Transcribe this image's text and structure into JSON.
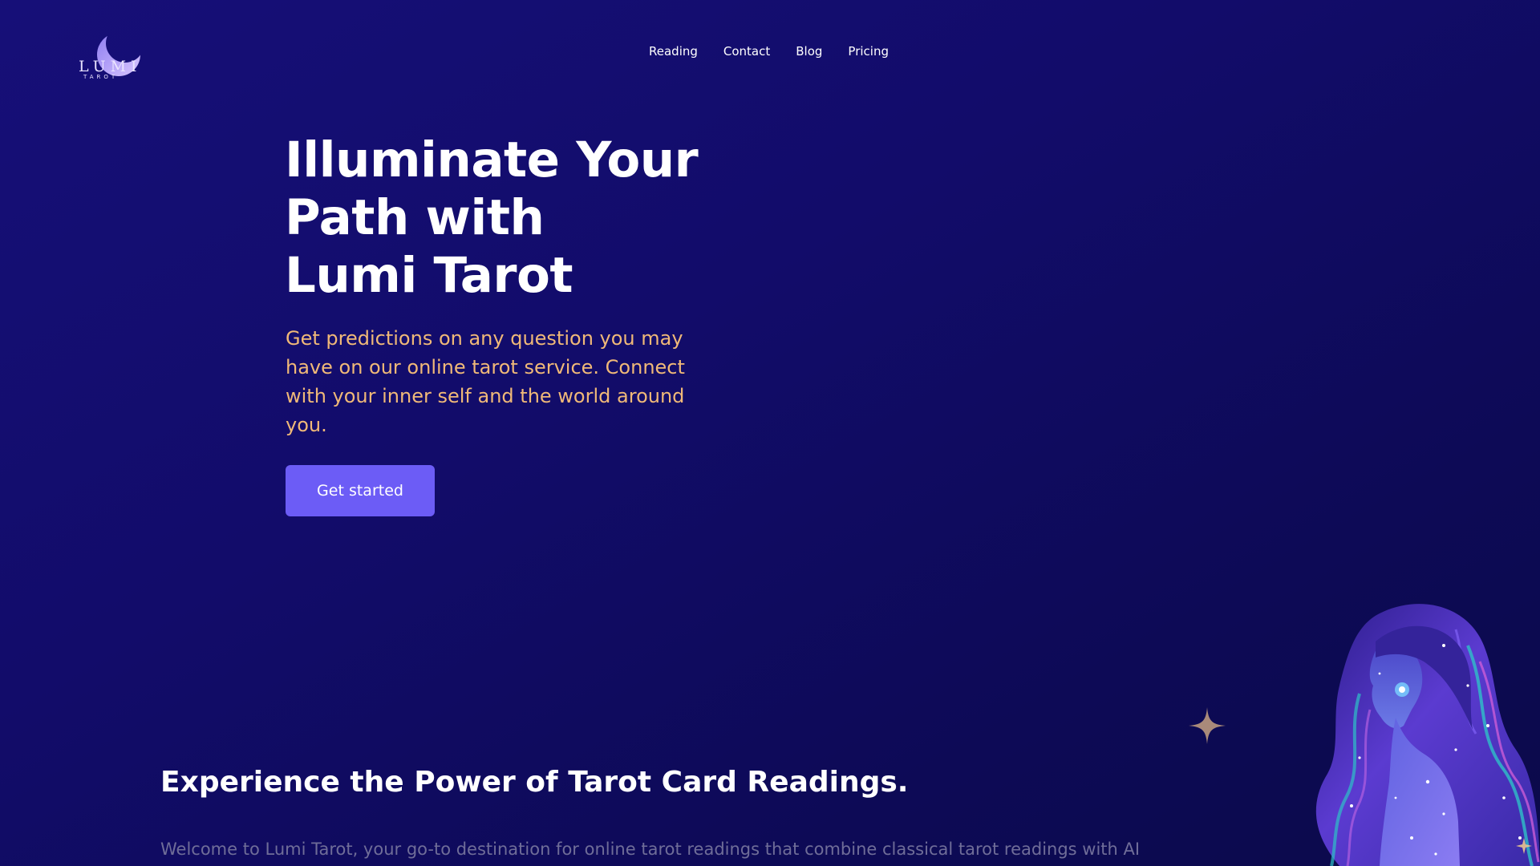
{
  "brand": {
    "name": "LUMI",
    "tagline": "TAROT",
    "icon": "crescent-moon-icon"
  },
  "nav": {
    "items": [
      {
        "label": "Reading"
      },
      {
        "label": "Contact"
      },
      {
        "label": "Blog"
      },
      {
        "label": "Pricing"
      }
    ]
  },
  "hero": {
    "title_lines": [
      "Illuminate Your",
      "Path with",
      "Lumi Tarot"
    ],
    "subtitle": "Get predictions on any question you may have on our online tarot service. Connect with your inner self and the world around you.",
    "cta_label": "Get started"
  },
  "section": {
    "title": "Experience the Power of Tarot Card Readings.",
    "body": "Welcome to Lumi Tarot, your go-to destination for online tarot readings that combine classical tarot readings with AI"
  },
  "decor": {
    "sparkle_icon": "four-point-star-icon",
    "illustration": "cosmic-woman-illustration"
  },
  "colors": {
    "background": "#130d6c",
    "accent": "#6c5cf6",
    "subtitle": "#f0b978",
    "body_text": "#6f6d98"
  }
}
